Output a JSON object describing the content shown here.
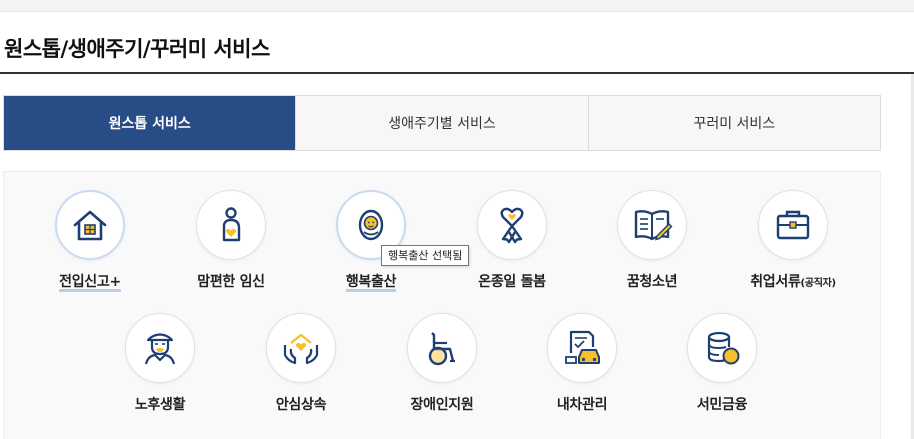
{
  "page_title": "원스톱/생애주기/꾸러미 서비스",
  "tabs": [
    {
      "label": "원스톱 서비스",
      "active": true
    },
    {
      "label": "생애주기별 서비스",
      "active": false
    },
    {
      "label": "꾸러미 서비스",
      "active": false
    }
  ],
  "services": [
    {
      "label": "전입신고",
      "suffix": "+",
      "icon": "house-icon"
    },
    {
      "label": "맘편한 임신",
      "icon": "pregnant-woman-icon"
    },
    {
      "label": "행복출산",
      "icon": "baby-icon"
    },
    {
      "label": "온종일 돌봄",
      "icon": "ribbon-heart-icon"
    },
    {
      "label": "꿈청소년",
      "icon": "open-book-icon"
    },
    {
      "label": "취업서류",
      "suffix": "(공직자)",
      "icon": "briefcase-icon"
    },
    {
      "label": "노후생활",
      "icon": "elderly-man-icon"
    },
    {
      "label": "안심상속",
      "icon": "hands-house-heart-icon"
    },
    {
      "label": "장애인지원",
      "icon": "wheelchair-icon"
    },
    {
      "label": "내차관리",
      "icon": "car-document-icon"
    },
    {
      "label": "서민금융",
      "icon": "coins-icon"
    }
  ],
  "tooltip": "행복출산 선택됨",
  "colors": {
    "active_tab": "#284c86",
    "icon_navy": "#1f3f72",
    "icon_yellow": "#f5c02a",
    "highlight": "#c9daf3"
  }
}
